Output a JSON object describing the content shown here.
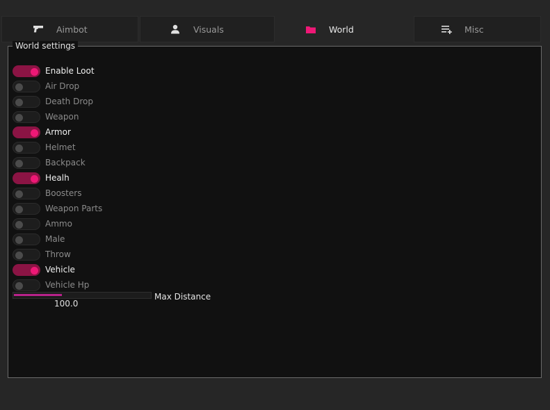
{
  "tabs": [
    {
      "label": "Aimbot",
      "icon": "pistol-icon",
      "active": false
    },
    {
      "label": "Visuals",
      "icon": "person-icon",
      "active": false
    },
    {
      "label": "World",
      "icon": "folder-icon",
      "active": true
    },
    {
      "label": "Misc",
      "icon": "list-add-icon",
      "active": false
    }
  ],
  "panel": {
    "title": "World settings",
    "toggles": [
      {
        "label": "Enable Loot",
        "on": true
      },
      {
        "label": "Air Drop",
        "on": false
      },
      {
        "label": "Death Drop",
        "on": false
      },
      {
        "label": "Weapon",
        "on": false
      },
      {
        "label": "Armor",
        "on": true
      },
      {
        "label": "Helmet",
        "on": false
      },
      {
        "label": "Backpack",
        "on": false
      },
      {
        "label": "Healh",
        "on": true
      },
      {
        "label": "Boosters",
        "on": false
      },
      {
        "label": "Weapon Parts",
        "on": false
      },
      {
        "label": "Ammo",
        "on": false
      },
      {
        "label": "Male",
        "on": false
      },
      {
        "label": "Throw",
        "on": false
      },
      {
        "label": "Vehicle",
        "on": true
      },
      {
        "label": "Vehicle Hp",
        "on": false
      }
    ],
    "slider": {
      "label": "Max Distance",
      "value": "100.0",
      "fraction": 0.35
    }
  },
  "colors": {
    "accent": "#ee1876",
    "accent_dark": "#8b1444",
    "panel_bg": "#111111",
    "window_bg": "#262626"
  }
}
